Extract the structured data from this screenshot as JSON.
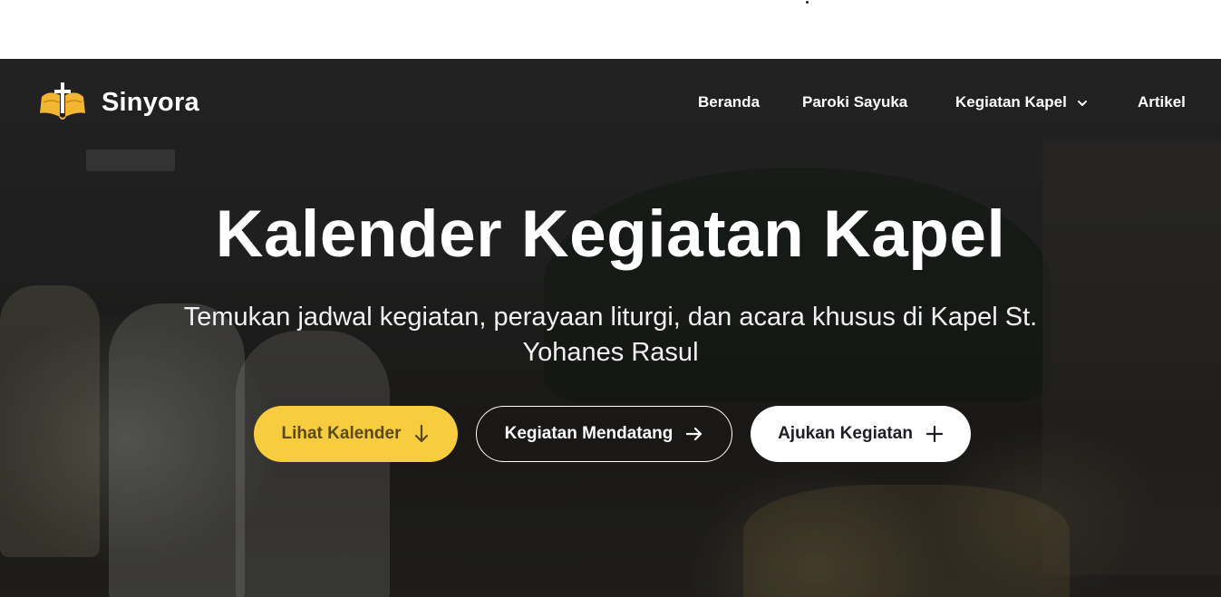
{
  "brand": {
    "name": "Sinyora",
    "logo_icon": "cross-wings-logo-icon",
    "accent": "#f2b632"
  },
  "nav": {
    "items": [
      {
        "label": "Beranda"
      },
      {
        "label": "Paroki Sayuka"
      },
      {
        "label": "Kegiatan Kapel",
        "icon": "chevron-down-icon"
      },
      {
        "label": "Artikel"
      }
    ]
  },
  "hero": {
    "title": "Kalender Kegiatan Kapel",
    "subtitle": "Temukan jadwal kegiatan, perayaan liturgi, dan acara khusus di Kapel St. Yohanes Rasul",
    "buttons": [
      {
        "label": "Lihat Kalender",
        "icon": "arrow-down-icon",
        "bg": "#f8cc3f"
      },
      {
        "label": "Kegiatan Mendatang",
        "icon": "arrow-right-icon",
        "bg": "transparent"
      },
      {
        "label": "Ajukan Kegiatan",
        "icon": "plus-icon",
        "bg": "#ffffff"
      }
    ]
  }
}
